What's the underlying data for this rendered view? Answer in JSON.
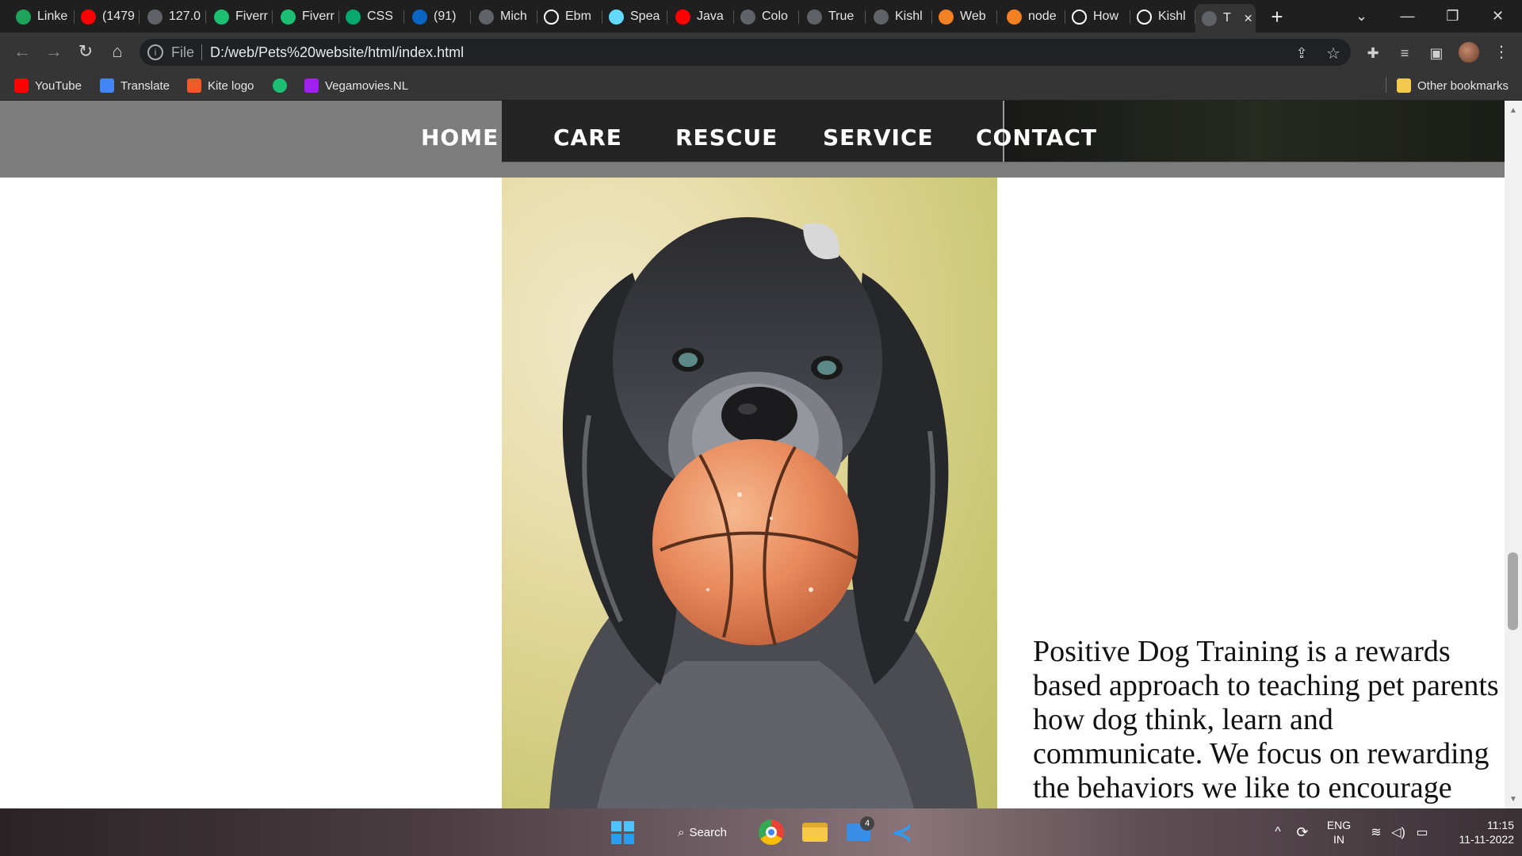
{
  "browser": {
    "tabs": [
      {
        "label": "Linke",
        "icon": "linkedin-learning-icon",
        "color": "#1fa35c"
      },
      {
        "label": "(1479",
        "icon": "youtube-icon",
        "color": "#ff0000"
      },
      {
        "label": "127.0",
        "icon": "globe-icon",
        "color": "#5f6368"
      },
      {
        "label": "Fiverr",
        "icon": "fiverr-icon",
        "color": "#1dbf73"
      },
      {
        "label": "Fiverr",
        "icon": "fiverr-icon",
        "color": "#1dbf73"
      },
      {
        "label": "CSS",
        "icon": "w3schools-icon",
        "color": "#04aa6d"
      },
      {
        "label": "(91)",
        "icon": "linkedin-icon",
        "color": "#0a66c2"
      },
      {
        "label": "Mich",
        "icon": "globe-icon",
        "color": "#5f6368"
      },
      {
        "label": "Ebm",
        "icon": "github-icon",
        "color": "#ffffff"
      },
      {
        "label": "Spea",
        "icon": "react-icon",
        "color": "#61dafb"
      },
      {
        "label": "Java",
        "icon": "youtube-icon",
        "color": "#ff0000"
      },
      {
        "label": "Colo",
        "icon": "globe-icon",
        "color": "#5f6368"
      },
      {
        "label": "True",
        "icon": "globe-icon",
        "color": "#5f6368"
      },
      {
        "label": "Kishl",
        "icon": "globe-icon",
        "color": "#5f6368"
      },
      {
        "label": "Web",
        "icon": "stackoverflow-icon",
        "color": "#f48024"
      },
      {
        "label": "node",
        "icon": "stackoverflow-icon",
        "color": "#f48024"
      },
      {
        "label": "How",
        "icon": "angular-icon",
        "color": "#ffffff"
      },
      {
        "label": "Kishl",
        "icon": "github-icon",
        "color": "#ffffff"
      },
      {
        "label": "T",
        "icon": "globe-icon",
        "color": "#5f6368"
      }
    ],
    "new_tab_symbol": "+",
    "address": {
      "scheme_label": "File",
      "url": "D:/web/Pets%20website/html/index.html"
    },
    "bookmarks": [
      {
        "label": "YouTube",
        "icon": "youtube-icon",
        "color": "#ff0000"
      },
      {
        "label": "Translate",
        "icon": "translate-icon",
        "color": "#4285f4"
      },
      {
        "label": "Kite logo",
        "icon": "kite-icon",
        "color": "#f05a28"
      },
      {
        "label": "",
        "icon": "fiverr-icon",
        "color": "#1dbf73"
      },
      {
        "label": "Vegamovies.NL",
        "icon": "vegamovies-icon",
        "color": "#a020f0"
      }
    ],
    "other_bookmarks": "Other bookmarks"
  },
  "site": {
    "nav": [
      "HOME",
      "CARE",
      "RESCUE",
      "SERVICE",
      "CONTACT"
    ],
    "paragraph": "Positive Dog Training is a rewards based approach to teaching pet parents how dog think, learn and communicate. We focus on rewarding the behaviors we like to encourage"
  },
  "taskbar": {
    "search_label": "Search",
    "mail_badge": "4",
    "lang_top": "ENG",
    "lang_bottom": "IN",
    "time": "11:15",
    "date": "11-11-2022"
  }
}
